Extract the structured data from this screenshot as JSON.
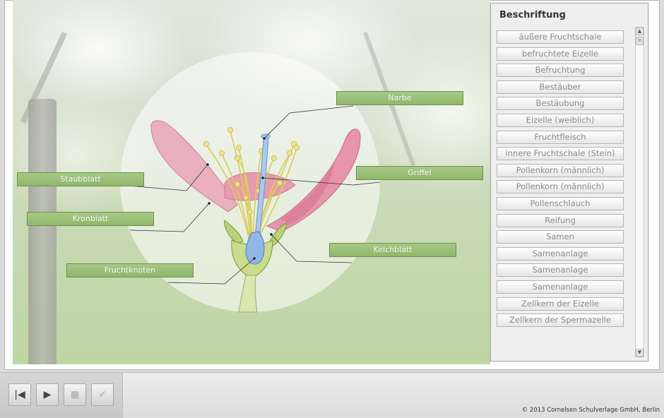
{
  "panel": {
    "title": "Beschriftung",
    "items": [
      "äußere Fruchtschale",
      "befruchtete Eizelle",
      "Befruchtung",
      "Bestäuber",
      "Bestäubung",
      "Eizelle (weiblich)",
      "Fruchtfleisch",
      "innere Fruchtschale (Stein)",
      "Pollenkorn (männlich)",
      "Pollenkorn (männlich)",
      "Pollenschlauch",
      "Reifung",
      "Samen",
      "Samenanlage",
      "Samenanlage",
      "Samenanlage",
      "Zellkern der Eizelle",
      "Zellkern der Spermazelle"
    ]
  },
  "labels": {
    "narbe": "Narbe",
    "staubblatt": "Staubblatt",
    "griffel": "Griffel",
    "kronblatt": "Kronblatt",
    "kelchblatt": "Kelchblatt",
    "fruchtknoten": "Fruchtknoten"
  },
  "toolbar": {
    "first_icon": "skip-to-start-icon",
    "play_icon": "play-icon",
    "stop_icon": "stop-icon",
    "check_icon": "checkmark-icon"
  },
  "footer": {
    "copyright": "© 2013 Cornelsen Schulverlage GmbH, Berlin"
  },
  "colors": {
    "label_green": "#8fb86b",
    "petal_pink": "#e9a3b4",
    "stamen_yellow": "#e8dc6a",
    "pistil_blue": "#8fb7e0"
  }
}
